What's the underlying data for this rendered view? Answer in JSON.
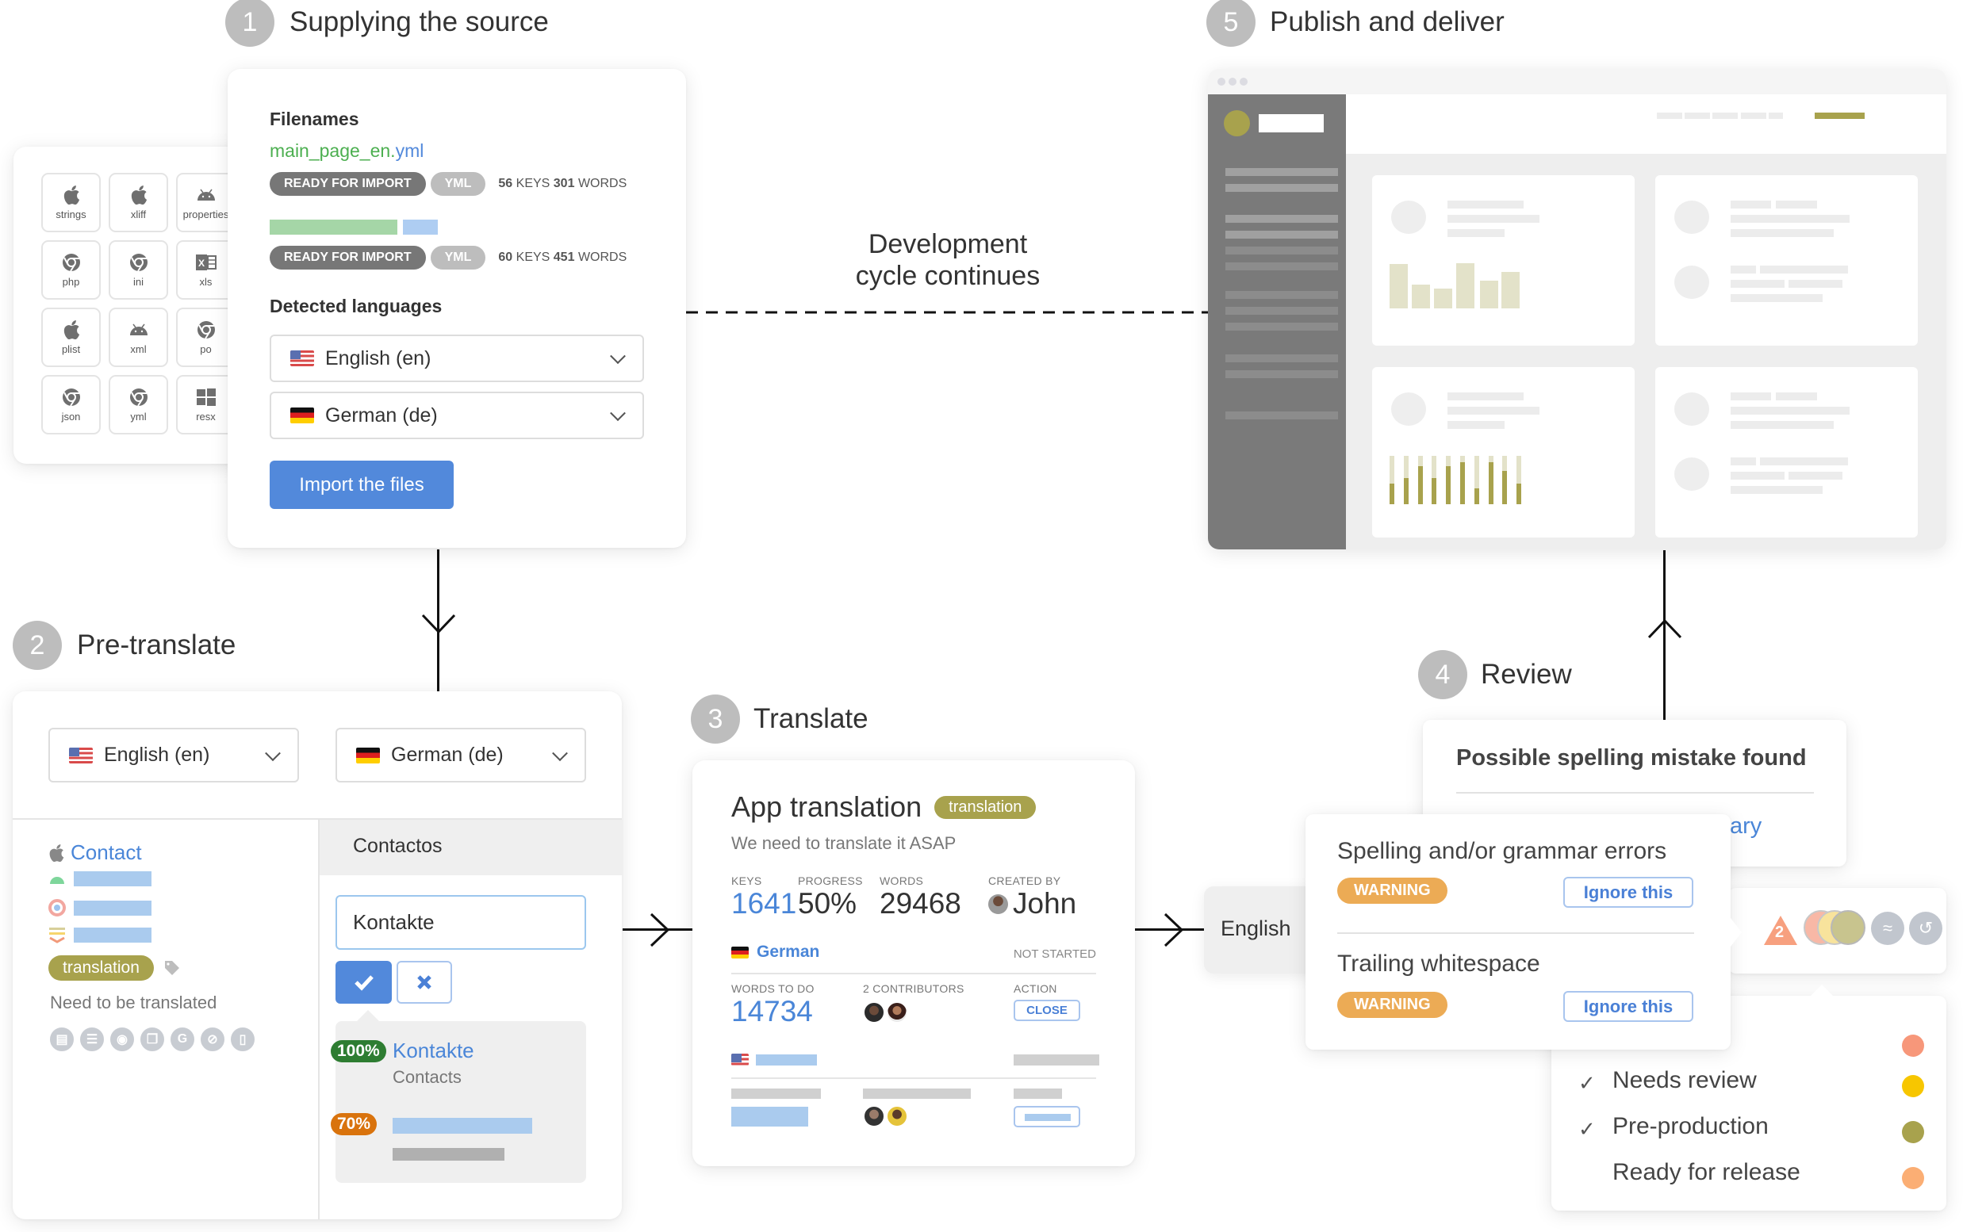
{
  "steps": [
    {
      "number": "1",
      "title": "Supplying the source"
    },
    {
      "number": "2",
      "title": "Pre-translate"
    },
    {
      "number": "3",
      "title": "Translate"
    },
    {
      "number": "4",
      "title": "Review"
    },
    {
      "number": "5",
      "title": "Publish and deliver"
    }
  ],
  "cycle_label": {
    "line1": "Development",
    "line2": "cycle continues"
  },
  "formats": [
    {
      "icon": "apple-icon",
      "label": "strings"
    },
    {
      "icon": "apple-icon",
      "label": "xliff"
    },
    {
      "icon": "android-icon",
      "label": "properties"
    },
    {
      "icon": "chrome-icon",
      "label": "php"
    },
    {
      "icon": "chrome-icon",
      "label": "ini"
    },
    {
      "icon": "excel-icon",
      "label": "xls"
    },
    {
      "icon": "apple-icon",
      "label": "plist"
    },
    {
      "icon": "android-icon",
      "label": "xml"
    },
    {
      "icon": "chrome-icon",
      "label": "po"
    },
    {
      "icon": "chrome-icon",
      "label": "json"
    },
    {
      "icon": "chrome-icon",
      "label": "yml"
    },
    {
      "icon": "windows-icon",
      "label": "resx"
    }
  ],
  "source": {
    "filenames_label": "Filenames",
    "filename_base": "main_page_en.",
    "filename_ext": "yml",
    "files": [
      {
        "status": "READY FOR IMPORT",
        "format": "YML",
        "keys": "56",
        "keys_label": "KEYS",
        "words": "301",
        "words_label": "WORDS"
      },
      {
        "status": "READY FOR IMPORT",
        "format": "YML",
        "keys": "60",
        "keys_label": "KEYS",
        "words": "451",
        "words_label": "WORDS"
      }
    ],
    "detected_label": "Detected languages",
    "languages": [
      {
        "flag": "us",
        "label": "English (en)"
      },
      {
        "flag": "de",
        "label": "German (de)"
      }
    ],
    "import_button": "Import the files"
  },
  "pretranslate": {
    "source_lang": "English (en)",
    "target_lang": "German (de)",
    "key_name": "Contact",
    "tag": "translation",
    "description": "Need to be translated",
    "header_value": "Contactos",
    "input_value": "Kontakte",
    "actions": [
      "comment",
      "clipboard",
      "screenshot",
      "copy",
      "google",
      "hide",
      "delete"
    ],
    "suggestions": [
      {
        "match": "100%",
        "text": "Kontakte",
        "source": "Contacts",
        "color": "#2e7d32"
      },
      {
        "match": "70%",
        "text": "",
        "source": "",
        "color": "#d9730d"
      }
    ]
  },
  "translate": {
    "project_title": "App translation",
    "tag": "translation",
    "description": "We need to translate it ASAP",
    "stats": [
      {
        "label": "KEYS",
        "value": "1641"
      },
      {
        "label": "PROGRESS",
        "value": "50%"
      },
      {
        "label": "WORDS",
        "value": "29468"
      },
      {
        "label": "CREATED BY",
        "value": "John"
      }
    ],
    "language": "German",
    "language_status": "NOT STARTED",
    "words_to_do_label": "WORDS TO DO",
    "words_to_do": "14734",
    "contributors_label": "2 CONTRIBUTORS",
    "action_label": "ACTION",
    "action_button": "CLOSE"
  },
  "review": {
    "source_lang": "English",
    "spelling_title": "Possible spelling mistake found",
    "spelling_link_fragment": "ary",
    "issues": [
      {
        "title": "Spelling and/or grammar errors",
        "level": "WARNING",
        "action": "Ignore this"
      },
      {
        "title": "Trailing whitespace",
        "level": "WARNING",
        "action": "Ignore this"
      }
    ],
    "qa_count": "2",
    "statuses": [
      {
        "label": "",
        "checked": false,
        "color": "#f7977a"
      },
      {
        "label": "Needs review",
        "checked": true,
        "color": "#f7c600"
      },
      {
        "label": "Pre-production",
        "checked": true,
        "color": "#a8a24d"
      },
      {
        "label": "Ready for release",
        "checked": false,
        "color": "#fbae74"
      }
    ]
  },
  "colors": {
    "accent_blue": "#5289db",
    "olive": "#a8a24d",
    "warning": "#ecab55",
    "green_filename": "#4caf50"
  }
}
